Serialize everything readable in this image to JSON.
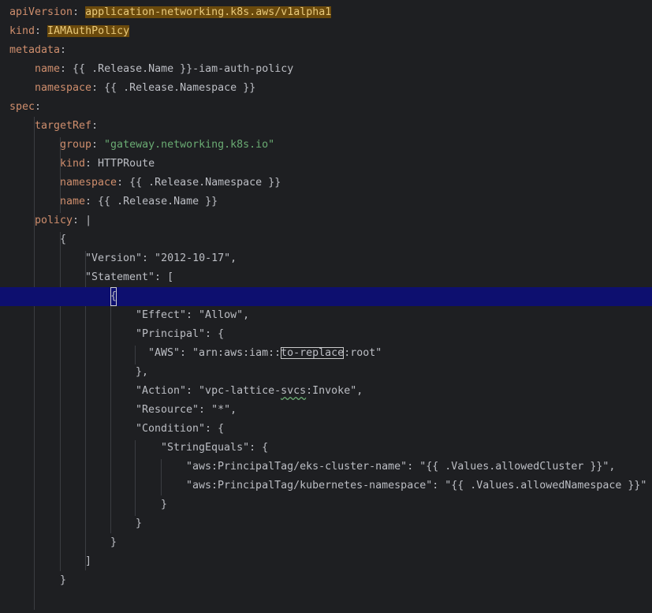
{
  "editor": {
    "lines": [
      {
        "k": "apiVersion",
        "sep": ": ",
        "v": "application-networking.k8s.aws/v1alpha1"
      },
      {
        "k": "kind",
        "sep": ": ",
        "v": "IAMAuthPolicy"
      },
      {
        "k": "metadata",
        "sep": ":"
      },
      {
        "k": "name",
        "sep": ": ",
        "v": "{{ .Release.Name }}-iam-auth-policy"
      },
      {
        "k": "namespace",
        "sep": ": ",
        "v": "{{ .Release.Namespace }}"
      },
      {
        "k": "spec",
        "sep": ":"
      },
      {
        "k": "targetRef",
        "sep": ":"
      },
      {
        "k": "group",
        "sep": ": ",
        "v": "\"gateway.networking.k8s.io\""
      },
      {
        "k": "kind",
        "sep": ": ",
        "v": "HTTPRoute"
      },
      {
        "k": "namespace",
        "sep": ": ",
        "v": "{{ .Release.Namespace }}"
      },
      {
        "k": "name",
        "sep": ": ",
        "v": "{{ .Release.Name }}"
      },
      {
        "k": "policy",
        "sep": ": ",
        "v": "|"
      },
      {
        "t": "{"
      },
      {
        "t": "\"Version\": \"2012-10-17\","
      },
      {
        "t": "\"Statement\": ["
      },
      {
        "t": "{"
      },
      {
        "t": "\"Effect\": \"Allow\","
      },
      {
        "t": "\"Principal\": {"
      },
      {
        "t1": "\"AWS\": \"arn:aws:iam::",
        "box": "to-replace",
        "t2": ":root\""
      },
      {
        "t": "},"
      },
      {
        "t1": "\"Action\": \"vpc-lattice-",
        "wavy": "svcs",
        "t2": ":Invoke\","
      },
      {
        "t": "\"Resource\": \"*\","
      },
      {
        "t": "\"Condition\": {"
      },
      {
        "t": "\"StringEquals\": {"
      },
      {
        "t": "\"aws:PrincipalTag/eks-cluster-name\": \"{{ .Values.allowedCluster }}\","
      },
      {
        "t": "\"aws:PrincipalTag/kubernetes-namespace\": \"{{ .Values.allowedNamespace }}\""
      },
      {
        "t": "}"
      },
      {
        "t": "}"
      },
      {
        "t": "}"
      },
      {
        "t": "]"
      },
      {
        "t": "}"
      }
    ]
  }
}
